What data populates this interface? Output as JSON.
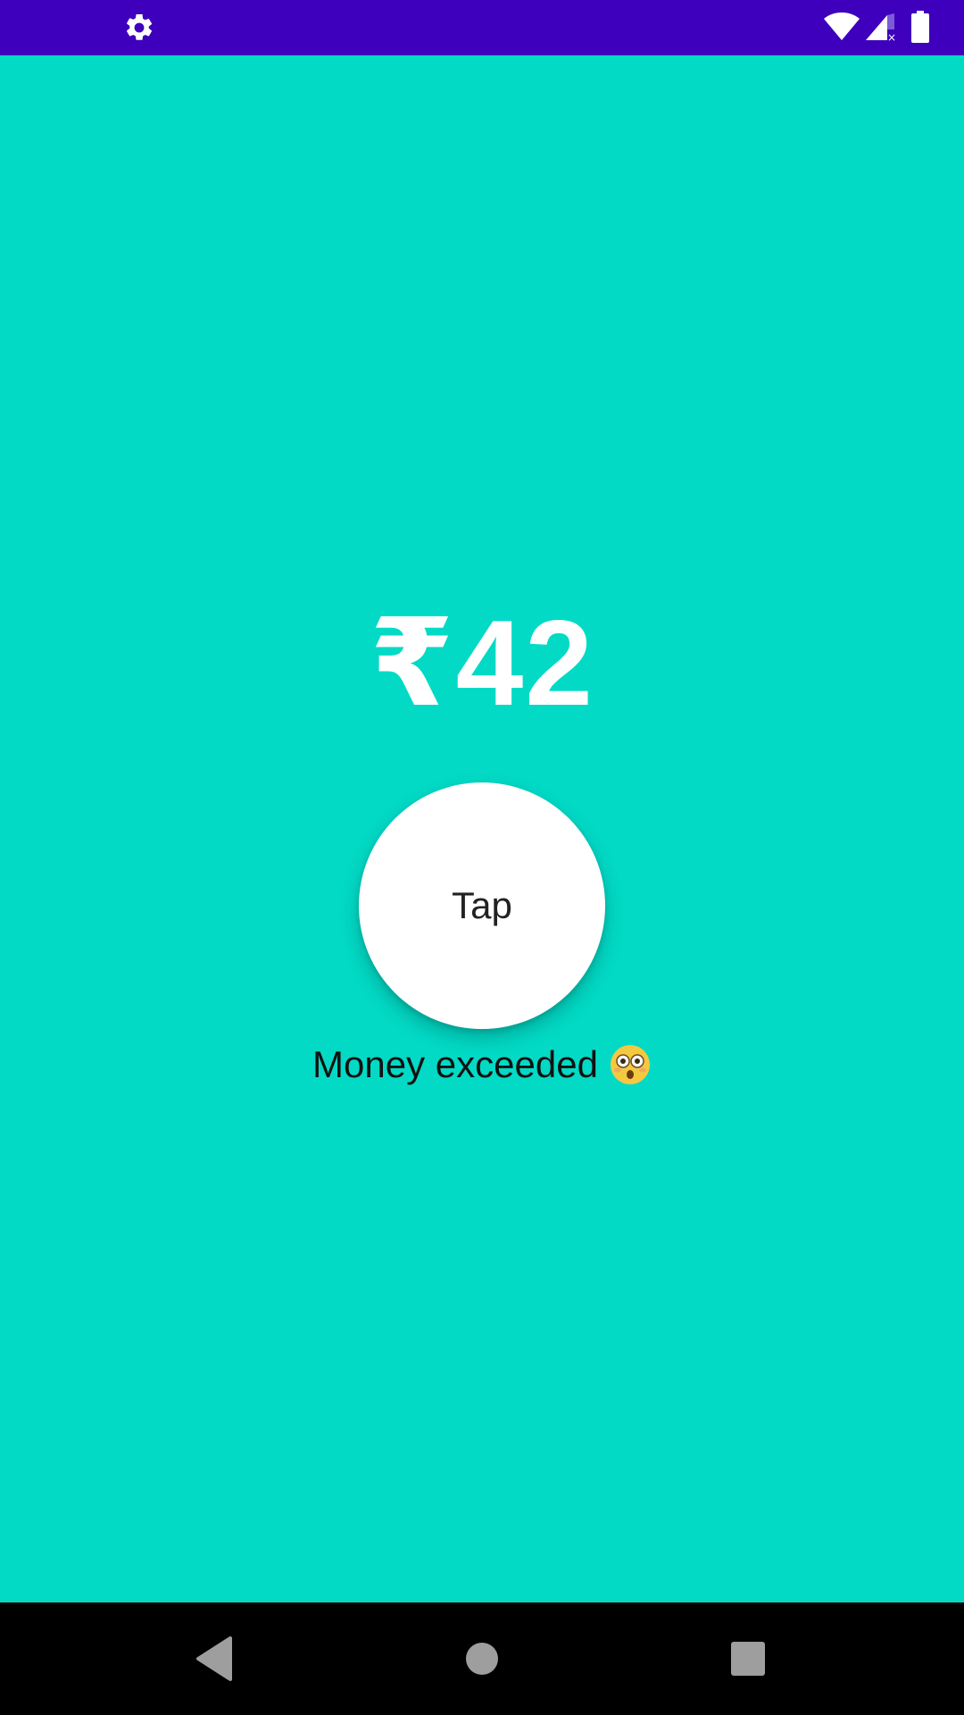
{
  "status_bar": {
    "icons": [
      "gear-icon",
      "wifi-icon",
      "signal-icon",
      "battery-icon"
    ],
    "background": "#3E00BD"
  },
  "main": {
    "background": "#02DAC6",
    "amount": "₹42",
    "tap_button_label": "Tap",
    "message": "Money exceeded",
    "message_emoji": "flushed-face-emoji"
  },
  "nav_bar": {
    "buttons": [
      "back-icon",
      "home-icon",
      "recents-icon"
    ]
  }
}
